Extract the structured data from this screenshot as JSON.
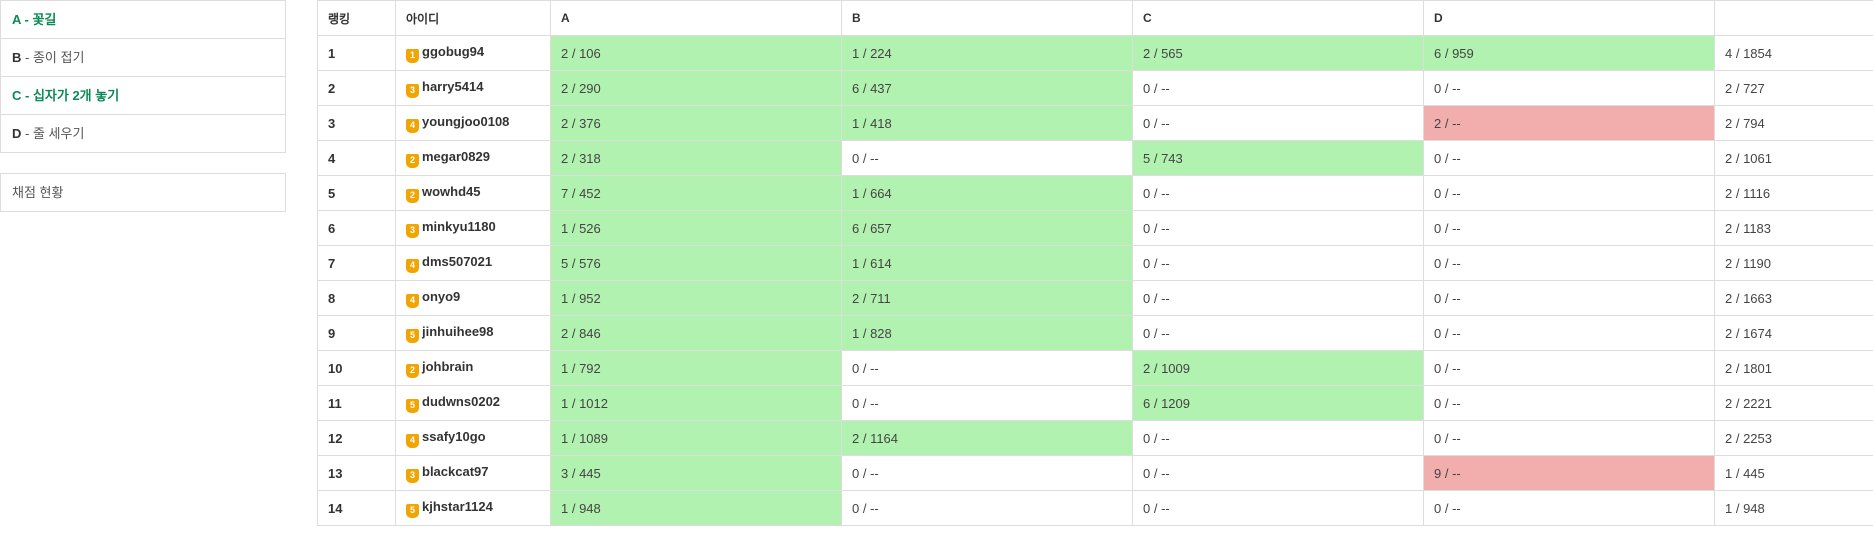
{
  "sidebar": {
    "problems": [
      {
        "id": "A",
        "sep": " - ",
        "title": "꽃길",
        "solved": true
      },
      {
        "id": "B",
        "sep": " - ",
        "title": "종이 접기",
        "solved": false
      },
      {
        "id": "C",
        "sep": " - ",
        "title": "십자가 2개 놓기",
        "solved": true
      },
      {
        "id": "D",
        "sep": " - ",
        "title": "줄 세우기",
        "solved": false
      }
    ],
    "status_label": "채점 현황"
  },
  "table": {
    "headers": [
      "랭킹",
      "아이디",
      "A",
      "B",
      "C",
      "D",
      ""
    ],
    "rows": [
      {
        "rank": "1",
        "tier": "1",
        "user": "ggobug94",
        "cells": [
          {
            "text": "2 / 106",
            "state": "ac"
          },
          {
            "text": "1 / 224",
            "state": "ac"
          },
          {
            "text": "2 / 565",
            "state": "ac"
          },
          {
            "text": "6 / 959",
            "state": "ac"
          }
        ],
        "total": "4 / 1854"
      },
      {
        "rank": "2",
        "tier": "3",
        "user": "harry5414",
        "cells": [
          {
            "text": "2 / 290",
            "state": "ac"
          },
          {
            "text": "6 / 437",
            "state": "ac"
          },
          {
            "text": "0 / --",
            "state": "none"
          },
          {
            "text": "0 / --",
            "state": "none"
          }
        ],
        "total": "2 / 727"
      },
      {
        "rank": "3",
        "tier": "4",
        "user": "youngjoo0108",
        "cells": [
          {
            "text": "2 / 376",
            "state": "ac"
          },
          {
            "text": "1 / 418",
            "state": "ac"
          },
          {
            "text": "0 / --",
            "state": "none"
          },
          {
            "text": "2 / --",
            "state": "wa"
          }
        ],
        "total": "2 / 794"
      },
      {
        "rank": "4",
        "tier": "2",
        "user": "megar0829",
        "cells": [
          {
            "text": "2 / 318",
            "state": "ac"
          },
          {
            "text": "0 / --",
            "state": "none"
          },
          {
            "text": "5 / 743",
            "state": "ac"
          },
          {
            "text": "0 / --",
            "state": "none"
          }
        ],
        "total": "2 / 1061"
      },
      {
        "rank": "5",
        "tier": "2",
        "user": "wowhd45",
        "cells": [
          {
            "text": "7 / 452",
            "state": "ac"
          },
          {
            "text": "1 / 664",
            "state": "ac"
          },
          {
            "text": "0 / --",
            "state": "none"
          },
          {
            "text": "0 / --",
            "state": "none"
          }
        ],
        "total": "2 / 1116"
      },
      {
        "rank": "6",
        "tier": "3",
        "user": "minkyu1180",
        "cells": [
          {
            "text": "1 / 526",
            "state": "ac"
          },
          {
            "text": "6 / 657",
            "state": "ac"
          },
          {
            "text": "0 / --",
            "state": "none"
          },
          {
            "text": "0 / --",
            "state": "none"
          }
        ],
        "total": "2 / 1183"
      },
      {
        "rank": "7",
        "tier": "4",
        "user": "dms507021",
        "cells": [
          {
            "text": "5 / 576",
            "state": "ac"
          },
          {
            "text": "1 / 614",
            "state": "ac"
          },
          {
            "text": "0 / --",
            "state": "none"
          },
          {
            "text": "0 / --",
            "state": "none"
          }
        ],
        "total": "2 / 1190"
      },
      {
        "rank": "8",
        "tier": "4",
        "user": "onyo9",
        "cells": [
          {
            "text": "1 / 952",
            "state": "ac"
          },
          {
            "text": "2 / 711",
            "state": "ac"
          },
          {
            "text": "0 / --",
            "state": "none"
          },
          {
            "text": "0 / --",
            "state": "none"
          }
        ],
        "total": "2 / 1663"
      },
      {
        "rank": "9",
        "tier": "5",
        "user": "jinhuihee98",
        "cells": [
          {
            "text": "2 / 846",
            "state": "ac"
          },
          {
            "text": "1 / 828",
            "state": "ac"
          },
          {
            "text": "0 / --",
            "state": "none"
          },
          {
            "text": "0 / --",
            "state": "none"
          }
        ],
        "total": "2 / 1674"
      },
      {
        "rank": "10",
        "tier": "2",
        "user": "johbrain",
        "cells": [
          {
            "text": "1 / 792",
            "state": "ac"
          },
          {
            "text": "0 / --",
            "state": "none"
          },
          {
            "text": "2 / 1009",
            "state": "ac"
          },
          {
            "text": "0 / --",
            "state": "none"
          }
        ],
        "total": "2 / 1801"
      },
      {
        "rank": "11",
        "tier": "5",
        "user": "dudwns0202",
        "cells": [
          {
            "text": "1 / 1012",
            "state": "ac"
          },
          {
            "text": "0 / --",
            "state": "none"
          },
          {
            "text": "6 / 1209",
            "state": "ac"
          },
          {
            "text": "0 / --",
            "state": "none"
          }
        ],
        "total": "2 / 2221"
      },
      {
        "rank": "12",
        "tier": "4",
        "user": "ssafy10go",
        "cells": [
          {
            "text": "1 / 1089",
            "state": "ac"
          },
          {
            "text": "2 / 1164",
            "state": "ac"
          },
          {
            "text": "0 / --",
            "state": "none"
          },
          {
            "text": "0 / --",
            "state": "none"
          }
        ],
        "total": "2 / 2253"
      },
      {
        "rank": "13",
        "tier": "3",
        "user": "blackcat97",
        "cells": [
          {
            "text": "3 / 445",
            "state": "ac"
          },
          {
            "text": "0 / --",
            "state": "none"
          },
          {
            "text": "0 / --",
            "state": "none"
          },
          {
            "text": "9 / --",
            "state": "wa"
          }
        ],
        "total": "1 / 445"
      },
      {
        "rank": "14",
        "tier": "5",
        "user": "kjhstar1124",
        "cells": [
          {
            "text": "1 / 948",
            "state": "ac"
          },
          {
            "text": "0 / --",
            "state": "none"
          },
          {
            "text": "0 / --",
            "state": "none"
          },
          {
            "text": "0 / --",
            "state": "none"
          }
        ],
        "total": "1 / 948"
      }
    ]
  },
  "colors": {
    "accepted": "#b2f2b0",
    "wrong": "#f2adad",
    "tier_badge": "#f0a500",
    "solved_link": "#0a8a55"
  },
  "icons": {
    "tier_badge": "tier-badge-icon"
  }
}
